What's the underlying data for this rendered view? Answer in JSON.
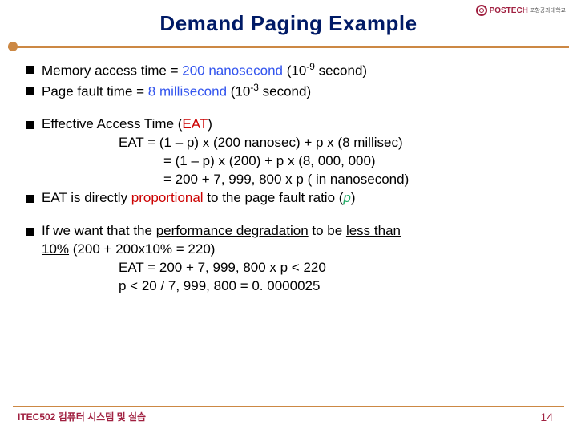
{
  "header": {
    "title": "Demand Paging Example",
    "logo_text": "POSTECH",
    "logo_sub": "포항공과대학교"
  },
  "bullets": {
    "b1_pre": "Memory access time = ",
    "b1_val": "200 nanosecond",
    "b1_post_a": " (10",
    "b1_sup": "-9",
    "b1_post_b": " second)",
    "b2_pre": "Page fault time = ",
    "b2_val": "8 millisecond",
    "b2_post_a": " (10",
    "b2_sup": "-3",
    "b2_post_b": " second)",
    "b3_pre": "Effective Access Time (",
    "b3_eat": "EAT",
    "b3_post": ")",
    "eat_l1": "EAT = (1 – p) x (200 nanosec) + p x (8 millisec)",
    "eat_l2": "= (1 – p) x (200) + p x (8, 000, 000)",
    "eat_l3": "= 200 + 7, 999, 800 x p ( in nanosecond)",
    "b4_pre": "EAT is directly ",
    "b4_prop": "proportional",
    "b4_mid": " to the page fault ratio (",
    "b4_p": "p",
    "b4_post": ")",
    "b5_line1_a": "If we want that the ",
    "b5_line1_u": "performance degradation",
    "b5_line1_b": " to be ",
    "b5_line1_u2": "less than",
    "b5_line2_u": "10%",
    "b5_line2_b": " (200 + 200x10% = 220)",
    "if_l1": "EAT = 200 + 7, 999, 800 x p < 220",
    "if_l2": "p < 20 / 7, 999, 800 = 0. 0000025"
  },
  "footer": {
    "course": "ITEC502 컴퓨터 시스템 및 실습",
    "page": "14"
  }
}
